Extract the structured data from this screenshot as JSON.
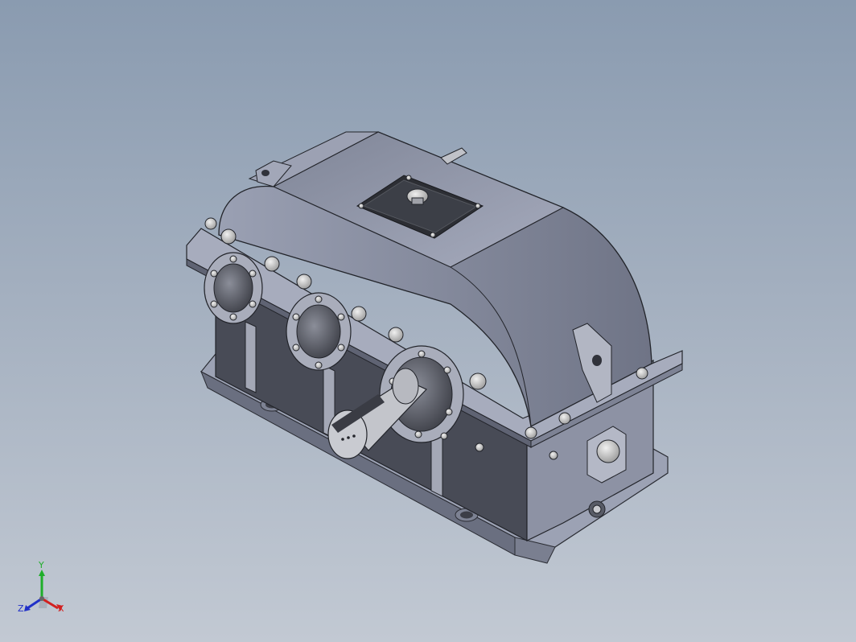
{
  "view": {
    "background_top": "#8a9bb0",
    "background_bottom": "#c2c9d3",
    "model_name": "",
    "body_color": "#8e93a6",
    "body_dark": "#4a4d59",
    "metal_color": "#b9bbc2"
  },
  "triad": {
    "x_label": "X",
    "y_label": "Y",
    "z_label": "Z",
    "x_color": "#d22020",
    "y_color": "#1fae2a",
    "z_color": "#2030c8"
  }
}
